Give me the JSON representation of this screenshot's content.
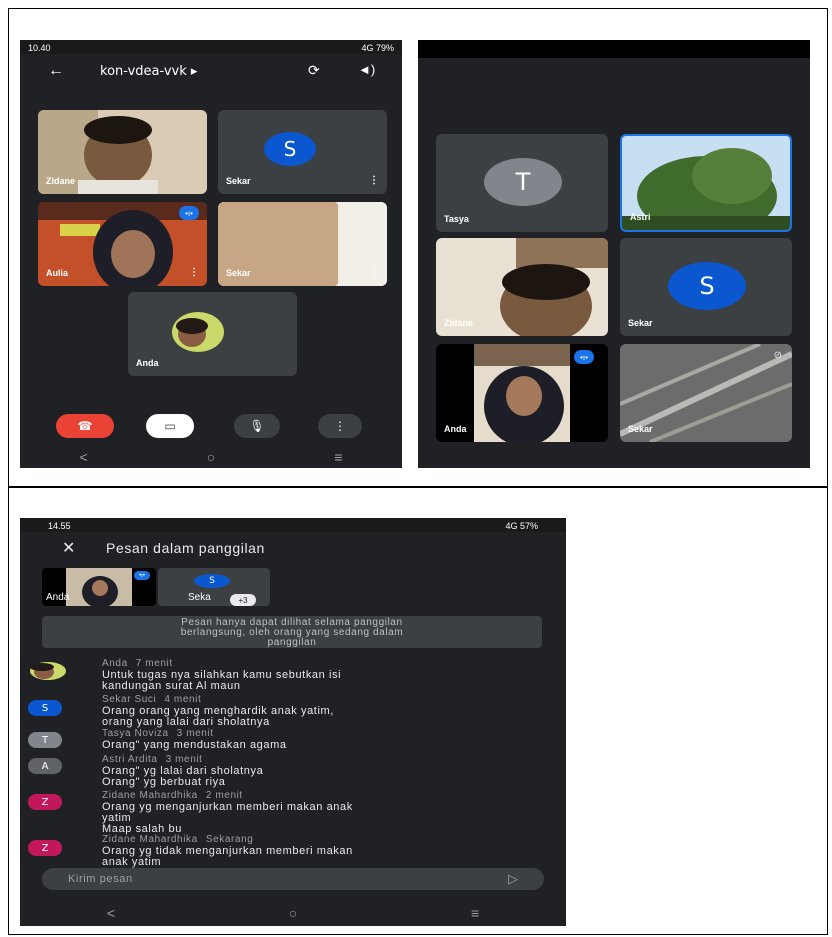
{
  "screen1": {
    "status_time": "10.40",
    "status_right": "4G 79%",
    "meeting_code": "kon-vdea-vvk ▸",
    "tiles": [
      {
        "name": "Zidane"
      },
      {
        "name": "Sekar",
        "initial": "S"
      },
      {
        "name": "Aulia"
      },
      {
        "name": "Sekar"
      },
      {
        "name": "Anda"
      }
    ]
  },
  "screen2": {
    "tiles": [
      {
        "name": "Tasya",
        "initial": "T"
      },
      {
        "name": "Astri"
      },
      {
        "name": "Zidane"
      },
      {
        "name": "Sekar",
        "initial": "S"
      },
      {
        "name": "Anda"
      },
      {
        "name": "Sekar"
      }
    ]
  },
  "screen3": {
    "status_time": "14.55",
    "status_right": "4G 57%",
    "title": "Pesan dalam panggilan",
    "thumb_anda": "Anda",
    "thumb_seka": "Seka",
    "thumb_seka_initial": "S",
    "thumb_more": "+3",
    "notice": [
      "Pesan hanya dapat dilihat selama panggilan",
      "berlangsung, oleh orang yang sedang dalam",
      "panggilan"
    ],
    "messages": [
      {
        "name": "Anda",
        "time": "7 menit",
        "lines": [
          "Untuk tugas nya silahkan kamu sebutkan isi",
          "kandungan surat Al maun"
        ]
      },
      {
        "name": "Sekar Suci",
        "time": "4 menit",
        "initial": "S",
        "lines": [
          "Orang orang yang menghardik anak yatim,",
          "orang yang lalai dari sholatnya"
        ]
      },
      {
        "name": "Tasya Noviza",
        "time": "3 menit",
        "initial": "T",
        "lines": [
          "Orang\" yang mendustakan agama"
        ]
      },
      {
        "name": "Astri Ardita",
        "time": "3 menit",
        "initial": "A",
        "lines": [
          "Orang\" yg lalai dari sholatnya",
          "Orang\" yg berbuat riya"
        ]
      },
      {
        "name": "Zidane Mahardhika",
        "time": "2 menit",
        "initial": "Z",
        "lines": [
          "Orang yg menganjurkan memberi makan anak",
          "yatim",
          "Maap salah bu"
        ]
      },
      {
        "name": "Zidane Mahardhika",
        "time": "Sekarang",
        "initial": "Z",
        "lines": [
          "Orang yg tidak menganjurkan memberi makan",
          "anak yatim"
        ]
      }
    ],
    "input_placeholder": "Kirim pesan"
  },
  "colors": {
    "avatar_blue": "#0b57d0",
    "avatar_grey": "#5f6368",
    "avatar_pink": "#c2185b",
    "end_call_red": "#ea4335"
  }
}
